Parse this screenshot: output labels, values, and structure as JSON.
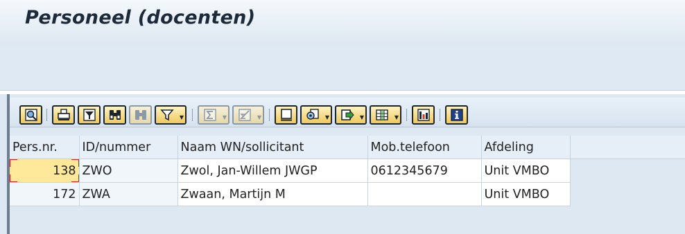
{
  "window": {
    "title": "Personeel (docenten)"
  },
  "alv_toolbar": {
    "buttons": [
      {
        "name": "details-button",
        "icon": "magnifier-details-icon"
      },
      {
        "name": "print-button",
        "icon": "printer-icon"
      },
      {
        "name": "filter-button",
        "icon": "filter-icon"
      },
      {
        "name": "find-button",
        "icon": "binoculars-icon"
      },
      {
        "name": "find-next-button",
        "icon": "binoculars-plus-icon"
      },
      {
        "name": "set-filter-button",
        "icon": "funnel-icon"
      },
      {
        "name": "total-button",
        "icon": "sigma-icon"
      },
      {
        "name": "subtotal-button",
        "icon": "subtotal-icon"
      },
      {
        "name": "print-preview-button",
        "icon": "document-icon"
      },
      {
        "name": "views-button",
        "icon": "views-icon"
      },
      {
        "name": "export-button",
        "icon": "export-icon"
      },
      {
        "name": "layout-button",
        "icon": "grid-layout-icon"
      },
      {
        "name": "graphic-button",
        "icon": "chart-icon"
      },
      {
        "name": "info-button",
        "icon": "info-icon"
      }
    ]
  },
  "grid": {
    "columns": [
      "Pers.nr.",
      "ID/nummer",
      "Naam WN/sollicitant",
      "Mob.telefoon",
      "Afdeling"
    ],
    "rows": [
      {
        "pers_nr": "138",
        "id": "ZWO",
        "naam": "Zwol, Jan-Willem JWGP",
        "mob": "0612345679",
        "afdeling": "Unit VMBO"
      },
      {
        "pers_nr": "172",
        "id": "ZWA",
        "naam": "Zwaan, Martijn M",
        "mob": "",
        "afdeling": "Unit VMBO"
      }
    ]
  },
  "colors": {
    "title_band": "#dde7f1",
    "alv_background": "#dde8f3",
    "selected_cell": "#fee99a",
    "button_face": "#f0c95c"
  }
}
